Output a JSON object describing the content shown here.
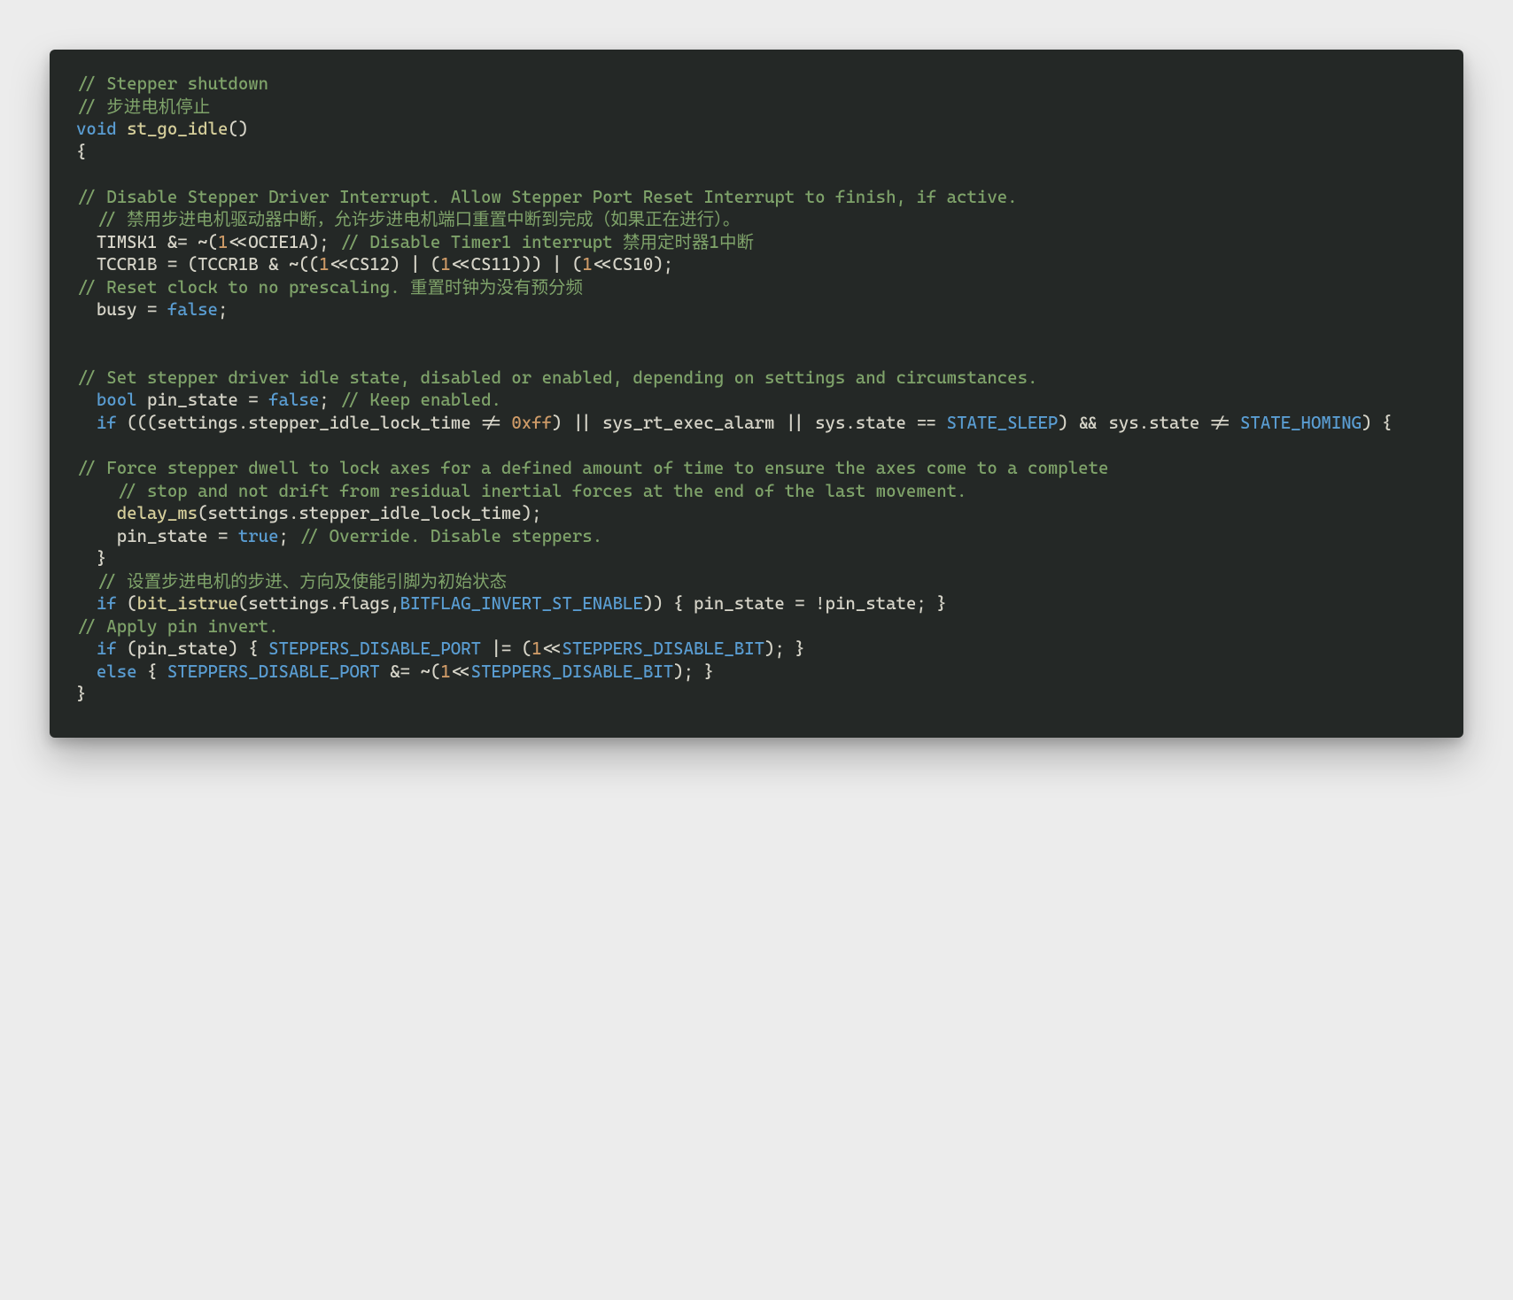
{
  "code": {
    "l01": "// Stepper shutdown",
    "l02": "// 步进电机停止",
    "l03_kw": "void",
    "l03_fn": " st_go_idle",
    "l03_rest": "()",
    "l04": "{",
    "l05": "",
    "l06": "// Disable Stepper Driver Interrupt. Allow Stepper Port Reset Interrupt to finish, if active.",
    "l07": "  // 禁用步进电机驱动器中断，允许步进电机端口重置中断到完成（如果正在进行）。",
    "l08a": "  TIMSK1 &= ~(",
    "l08_num": "1",
    "l08b": "<<OCIE1A); ",
    "l08_cmt": "// Disable Timer1 interrupt 禁用定时器1中断",
    "l09a": "  TCCR1B = (TCCR1B & ~((",
    "l09n1": "1",
    "l09b": "<<CS12) | (",
    "l09n2": "1",
    "l09c": "<<CS11))) | (",
    "l09n3": "1",
    "l09d": "<<CS10);",
    "l10": "// Reset clock to no prescaling. 重置时钟为没有预分频",
    "l11a": "  busy = ",
    "l11_false": "false",
    "l11b": ";",
    "l12": "",
    "l13": "",
    "l14": "// Set stepper driver idle state, disabled or enabled, depending on settings and circumstances.",
    "l15a": "  ",
    "l15_kw": "bool",
    "l15b": " pin_state = ",
    "l15_false": "false",
    "l15c": "; ",
    "l15_cmt": "// Keep enabled.",
    "l16a": "  ",
    "l16_if": "if",
    "l16b": " (((settings.stepper_idle_lock_time != ",
    "l16_hex": "0xff",
    "l16c": ") || sys_rt_exec_alarm || sys.state == ",
    "l16_sleep": "STATE_SLEEP",
    "l16d": ") && sys.state != ",
    "l16_homing": "STATE_HOMING",
    "l16e": ") {",
    "l17": "",
    "l18": "// Force stepper dwell to lock axes for a defined amount of time to ensure the axes come to a complete",
    "l19": "    // stop and not drift from residual inertial forces at the end of the last movement.",
    "l20a": "    ",
    "l20_fn": "delay_ms",
    "l20b": "(settings.stepper_idle_lock_time);",
    "l21a": "    pin_state = ",
    "l21_true": "true",
    "l21b": "; ",
    "l21_cmt": "// Override. Disable steppers.",
    "l22": "  }",
    "l23": "  // 设置步进电机的步进、方向及使能引脚为初始状态",
    "l24a": "  ",
    "l24_if": "if",
    "l24b": " (",
    "l24_fn": "bit_istrue",
    "l24c": "(settings.flags,",
    "l24_flag": "BITFLAG_INVERT_ST_ENABLE",
    "l24d": ")) { pin_state = !pin_state; }",
    "l25": "// Apply pin invert.",
    "l26a": "  ",
    "l26_if": "if",
    "l26b": " (pin_state) { ",
    "l26_port": "STEPPERS_DISABLE_PORT",
    "l26c": " |= (",
    "l26_n": "1",
    "l26d": "<<",
    "l26_bit": "STEPPERS_DISABLE_BIT",
    "l26e": "); }",
    "l27a": "  ",
    "l27_else": "else",
    "l27b": " { ",
    "l27_port": "STEPPERS_DISABLE_PORT",
    "l27c": " &= ~(",
    "l27_n": "1",
    "l27d": "<<",
    "l27_bit": "STEPPERS_DISABLE_BIT",
    "l27e": "); }",
    "l28": "}"
  }
}
